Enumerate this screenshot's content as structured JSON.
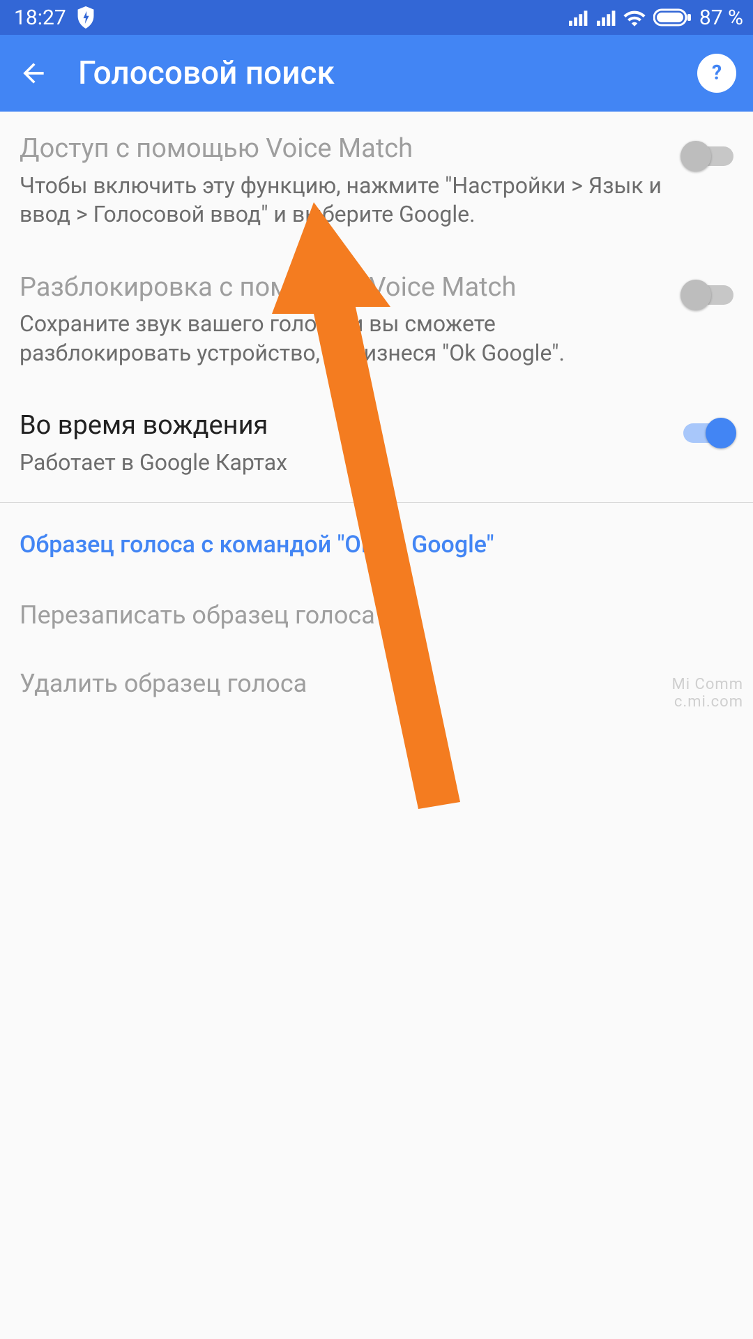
{
  "statusbar": {
    "time": "18:27",
    "battery": "87 %"
  },
  "appbar": {
    "title": "Голосовой поиск"
  },
  "settings": [
    {
      "title": "Доступ с помощью Voice Match",
      "desc": "Чтобы включить эту функцию, нажмите \"Настройки > Язык и ввод > Голосовой ввод\" и выберите Google.",
      "enabled": false,
      "toggle": false
    },
    {
      "title": "Разблокировка с помощью Voice Match",
      "desc": "Сохраните звук вашего голоса, и вы сможете разблокировать устройство, произнеся \"Ok Google\".",
      "enabled": false,
      "toggle": false
    },
    {
      "title": "Во время вождения",
      "desc": "Работает в Google Картах",
      "enabled": true,
      "toggle": true
    }
  ],
  "section": {
    "header": "Образец голоса с командой \"Окей, Google\"",
    "items": [
      "Перезаписать образец голоса",
      "Удалить образец голоса"
    ]
  },
  "watermark": {
    "line1": "Mi Comm",
    "line2": "c.mi.com"
  }
}
